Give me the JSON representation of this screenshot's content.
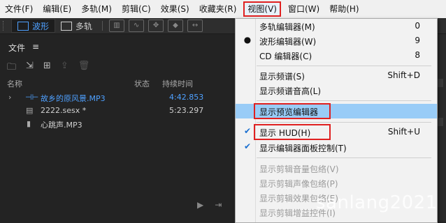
{
  "menubar": {
    "items": [
      "文件(F)",
      "编辑(E)",
      "多轨(M)",
      "剪辑(C)",
      "效果(S)",
      "收藏夹(R)",
      "视图(V)",
      "窗口(W)",
      "帮助(H)"
    ]
  },
  "toolbar": {
    "waveform_label": "波形",
    "multitrack_label": "多轨"
  },
  "files_panel": {
    "title": "文件",
    "menu_icon": "≡",
    "columns": {
      "name": "名称",
      "status": "状态",
      "duration": "持续时间"
    },
    "files": [
      {
        "name": "故乡的原风景.MP3",
        "duration": "4:42.853"
      },
      {
        "name": "2222.sesx *",
        "duration": "5:23.297"
      },
      {
        "name": "心跳声.MP3",
        "duration": ""
      }
    ]
  },
  "view_menu": {
    "items": [
      {
        "label": "多轨编辑器(M)",
        "shortcut": "0"
      },
      {
        "label": "波形编辑器(W)",
        "shortcut": "9"
      },
      {
        "label": "CD 编辑器(C)",
        "shortcut": "8"
      },
      {
        "label": "显示频谱(S)",
        "shortcut": "Shift+D"
      },
      {
        "label": "显示频谱音高(L)",
        "shortcut": ""
      },
      {
        "label": "显示预览编辑器",
        "shortcut": ""
      },
      {
        "label": "显示 HUD(H)",
        "shortcut": "Shift+U"
      },
      {
        "label": "显示编辑器面板控制(T)",
        "shortcut": ""
      },
      {
        "label": "显示剪辑音量包络(V)",
        "shortcut": ""
      },
      {
        "label": "显示剪辑声像包络(P)",
        "shortcut": ""
      },
      {
        "label": "显示剪辑效果包络(E)",
        "shortcut": ""
      },
      {
        "label": "显示剪辑增益控件(I)",
        "shortcut": ""
      }
    ]
  },
  "watermark": "sanlang2021"
}
